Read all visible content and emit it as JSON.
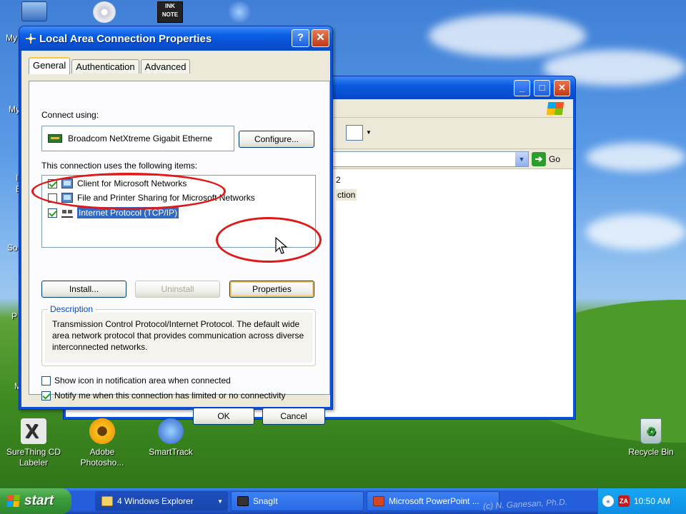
{
  "desktop": {
    "icons": [
      {
        "label": "SureThing CD Labeler",
        "icon": "surething-icon"
      },
      {
        "label": "Adobe Photosho...",
        "icon": "photoshop-icon"
      },
      {
        "label": "SmartTrack",
        "icon": "smarttrack-icon"
      },
      {
        "label": "Recycle Bin",
        "icon": "recycle-bin-icon"
      }
    ],
    "edge_labels": [
      "My",
      "My",
      "I",
      "E",
      "So",
      "P",
      "M"
    ]
  },
  "explorer_window": {
    "address_go_label": "Go",
    "content_lines": [
      "2",
      "ction"
    ]
  },
  "dialog": {
    "title": "Local Area Connection Properties",
    "help_label": "?",
    "close_label": "X",
    "tabs": [
      {
        "label": "General",
        "active": true
      },
      {
        "label": "Authentication",
        "active": false
      },
      {
        "label": "Advanced",
        "active": false
      }
    ],
    "connect_using_label": "Connect using:",
    "adapter_name": "Broadcom NetXtreme Gigabit Etherne",
    "configure_label": "Configure...",
    "items_label": "This connection uses the following items:",
    "items": [
      {
        "label": "Client for Microsoft Networks",
        "checked": true,
        "selected": false,
        "icon": "network-client-icon"
      },
      {
        "label": "File and Printer Sharing for Microsoft Networks",
        "checked": false,
        "selected": false,
        "icon": "file-printer-sharing-icon"
      },
      {
        "label": "Internet Protocol (TCP/IP)",
        "checked": true,
        "selected": true,
        "icon": "protocol-icon"
      }
    ],
    "install_label": "Install...",
    "uninstall_label": "Uninstall",
    "properties_label": "Properties",
    "description_title": "Description",
    "description_text": "Transmission Control Protocol/Internet Protocol. The default wide area network protocol that provides communication across diverse interconnected networks.",
    "show_icon_label": "Show icon in notification area when connected",
    "show_icon_checked": false,
    "notify_label": "Notify me when this connection has limited or no connectivity",
    "notify_checked": true,
    "ok_label": "OK",
    "cancel_label": "Cancel"
  },
  "taskbar": {
    "start_label": "start",
    "tasks": [
      {
        "label": "4 Windows Explorer",
        "icon": "folder-icon",
        "active": true
      },
      {
        "label": "SnagIt",
        "icon": "snagit-icon",
        "active": false
      },
      {
        "label": "Microsoft PowerPoint ...",
        "icon": "powerpoint-icon",
        "active": false
      }
    ],
    "clock": "10:50 AM",
    "watermark": "(c) N. Ganesan, Ph.D."
  },
  "colors": {
    "xp_blue": "#0a50d8",
    "dialog_bg": "#ece9d8",
    "selection": "#316ac5",
    "annotation_red": "#e01818",
    "start_green": "#3c9c3c"
  }
}
